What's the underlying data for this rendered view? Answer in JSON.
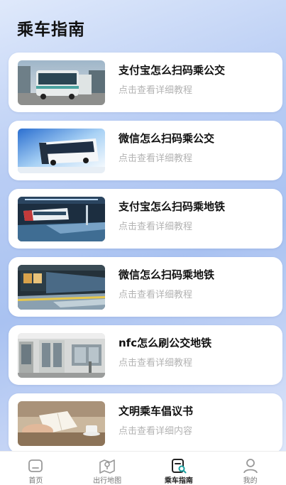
{
  "page": {
    "title": "乘车指南"
  },
  "guides": [
    {
      "title": "支付宝怎么扫码乘公交",
      "subtitle": "点击查看详细教程",
      "image": "bus-photo-daylight"
    },
    {
      "title": "微信怎么扫码乘公交",
      "subtitle": "点击查看详细教程",
      "image": "bus-photo-blue-light"
    },
    {
      "title": "支付宝怎么扫码乘地铁",
      "subtitle": "点击查看详细教程",
      "image": "metro-station-photo"
    },
    {
      "title": "微信怎么扫码乘地铁",
      "subtitle": "点击查看详细教程",
      "image": "metro-platform-photo"
    },
    {
      "title": "nfc怎么刷公交地铁",
      "subtitle": "点击查看详细教程",
      "image": "train-interior-photo"
    },
    {
      "title": "文明乘车倡议书",
      "subtitle": "点击查看详细内容",
      "image": "reading-book-photo"
    }
  ],
  "tabbar": {
    "tabs": [
      {
        "label": "首页",
        "icon": "home-icon"
      },
      {
        "label": "出行地图",
        "icon": "map-icon"
      },
      {
        "label": "乘车指南",
        "icon": "guide-icon",
        "active": true
      },
      {
        "label": "我的",
        "icon": "profile-icon"
      }
    ]
  }
}
